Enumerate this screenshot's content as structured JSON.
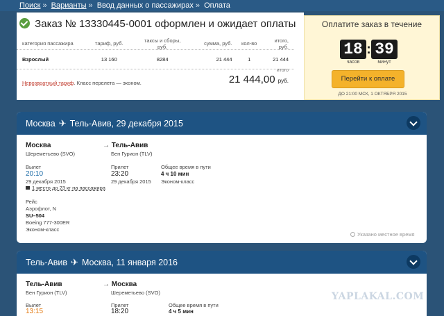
{
  "breadcrumb": {
    "items": [
      "Поиск",
      "Варианты",
      "Ввод данных о пассажирах",
      "Оплата"
    ],
    "separator": "»"
  },
  "order": {
    "title": "Заказ № 13330445-0001 оформлен и ожидает оплаты",
    "columns": [
      "категория пассажира",
      "тариф, руб.",
      "таксы и сборы, руб.",
      "сумма, руб.",
      "кол-во",
      "итого, руб."
    ],
    "row": [
      "Взрослый",
      "13 160",
      "8284",
      "21 444",
      "1",
      "21 444"
    ],
    "nonrefundable_link": "Невозвратный тариф",
    "class_note": ". Класс перелета — эконом.",
    "total_label": "итого",
    "total_amount": "21 444,00",
    "total_currency": "руб."
  },
  "timer": {
    "title": "Оплатите заказ в течение",
    "hours": "18",
    "minutes": "39",
    "hours_label": "часов",
    "minutes_label": "минут",
    "pay_button": "Перейти к оплате",
    "deadline": "ДО 21:00 МСК, 1 ОКТЯБРЯ 2015"
  },
  "flight1": {
    "header_from": "Москва",
    "header_to": "Тель-Авив, 29 декабря 2015",
    "from_city": "Москва",
    "from_airport": "Шереметьево (SVO)",
    "to_city": "Тель-Авив",
    "to_airport": "Бен Гурион (TLV)",
    "depart_label": "Вылет",
    "depart_time": "20:10",
    "depart_date": "29 декабря 2015",
    "baggage": "1 место до 23 кг на пассажира",
    "arrive_label": "Прилет",
    "arrive_time": "23:20",
    "arrive_date": "29 декабря 2015",
    "duration_label": "Общее время в пути",
    "duration": "4 ч 10 мин",
    "cabin": "Эконом-класс",
    "flight_label": "Рейс",
    "airline": "Аэрофлот, N",
    "flight_no": "SU–504",
    "aircraft": "Boeing 777-300ER",
    "flight_cabin": "Эконом-класс",
    "local_time_note": "Указано местное время"
  },
  "flight2": {
    "header_from": "Тель-Авив",
    "header_to": "Москва, 11 января 2016",
    "from_city": "Тель-Авив",
    "from_airport": "Бен Гурион (TLV)",
    "to_city": "Москва",
    "to_airport": "Шереметьево (SVO)",
    "depart_label": "Вылет",
    "depart_time": "13:15",
    "arrive_label": "Прилет",
    "arrive_time": "18:20",
    "duration_label": "Общее время в пути",
    "duration": "4 ч 5 мин"
  },
  "watermark": "YAPLAKAL.COM",
  "colors": {
    "page_bg": "#2b5377",
    "card_header": "#1e5383",
    "pay_button": "#f4b22b",
    "time_blue": "#1a6aa6",
    "time_orange": "#e37a12"
  },
  "icons": [
    "check-icon",
    "plane-icon",
    "chevron-down-icon",
    "luggage-icon",
    "clock-icon"
  ]
}
